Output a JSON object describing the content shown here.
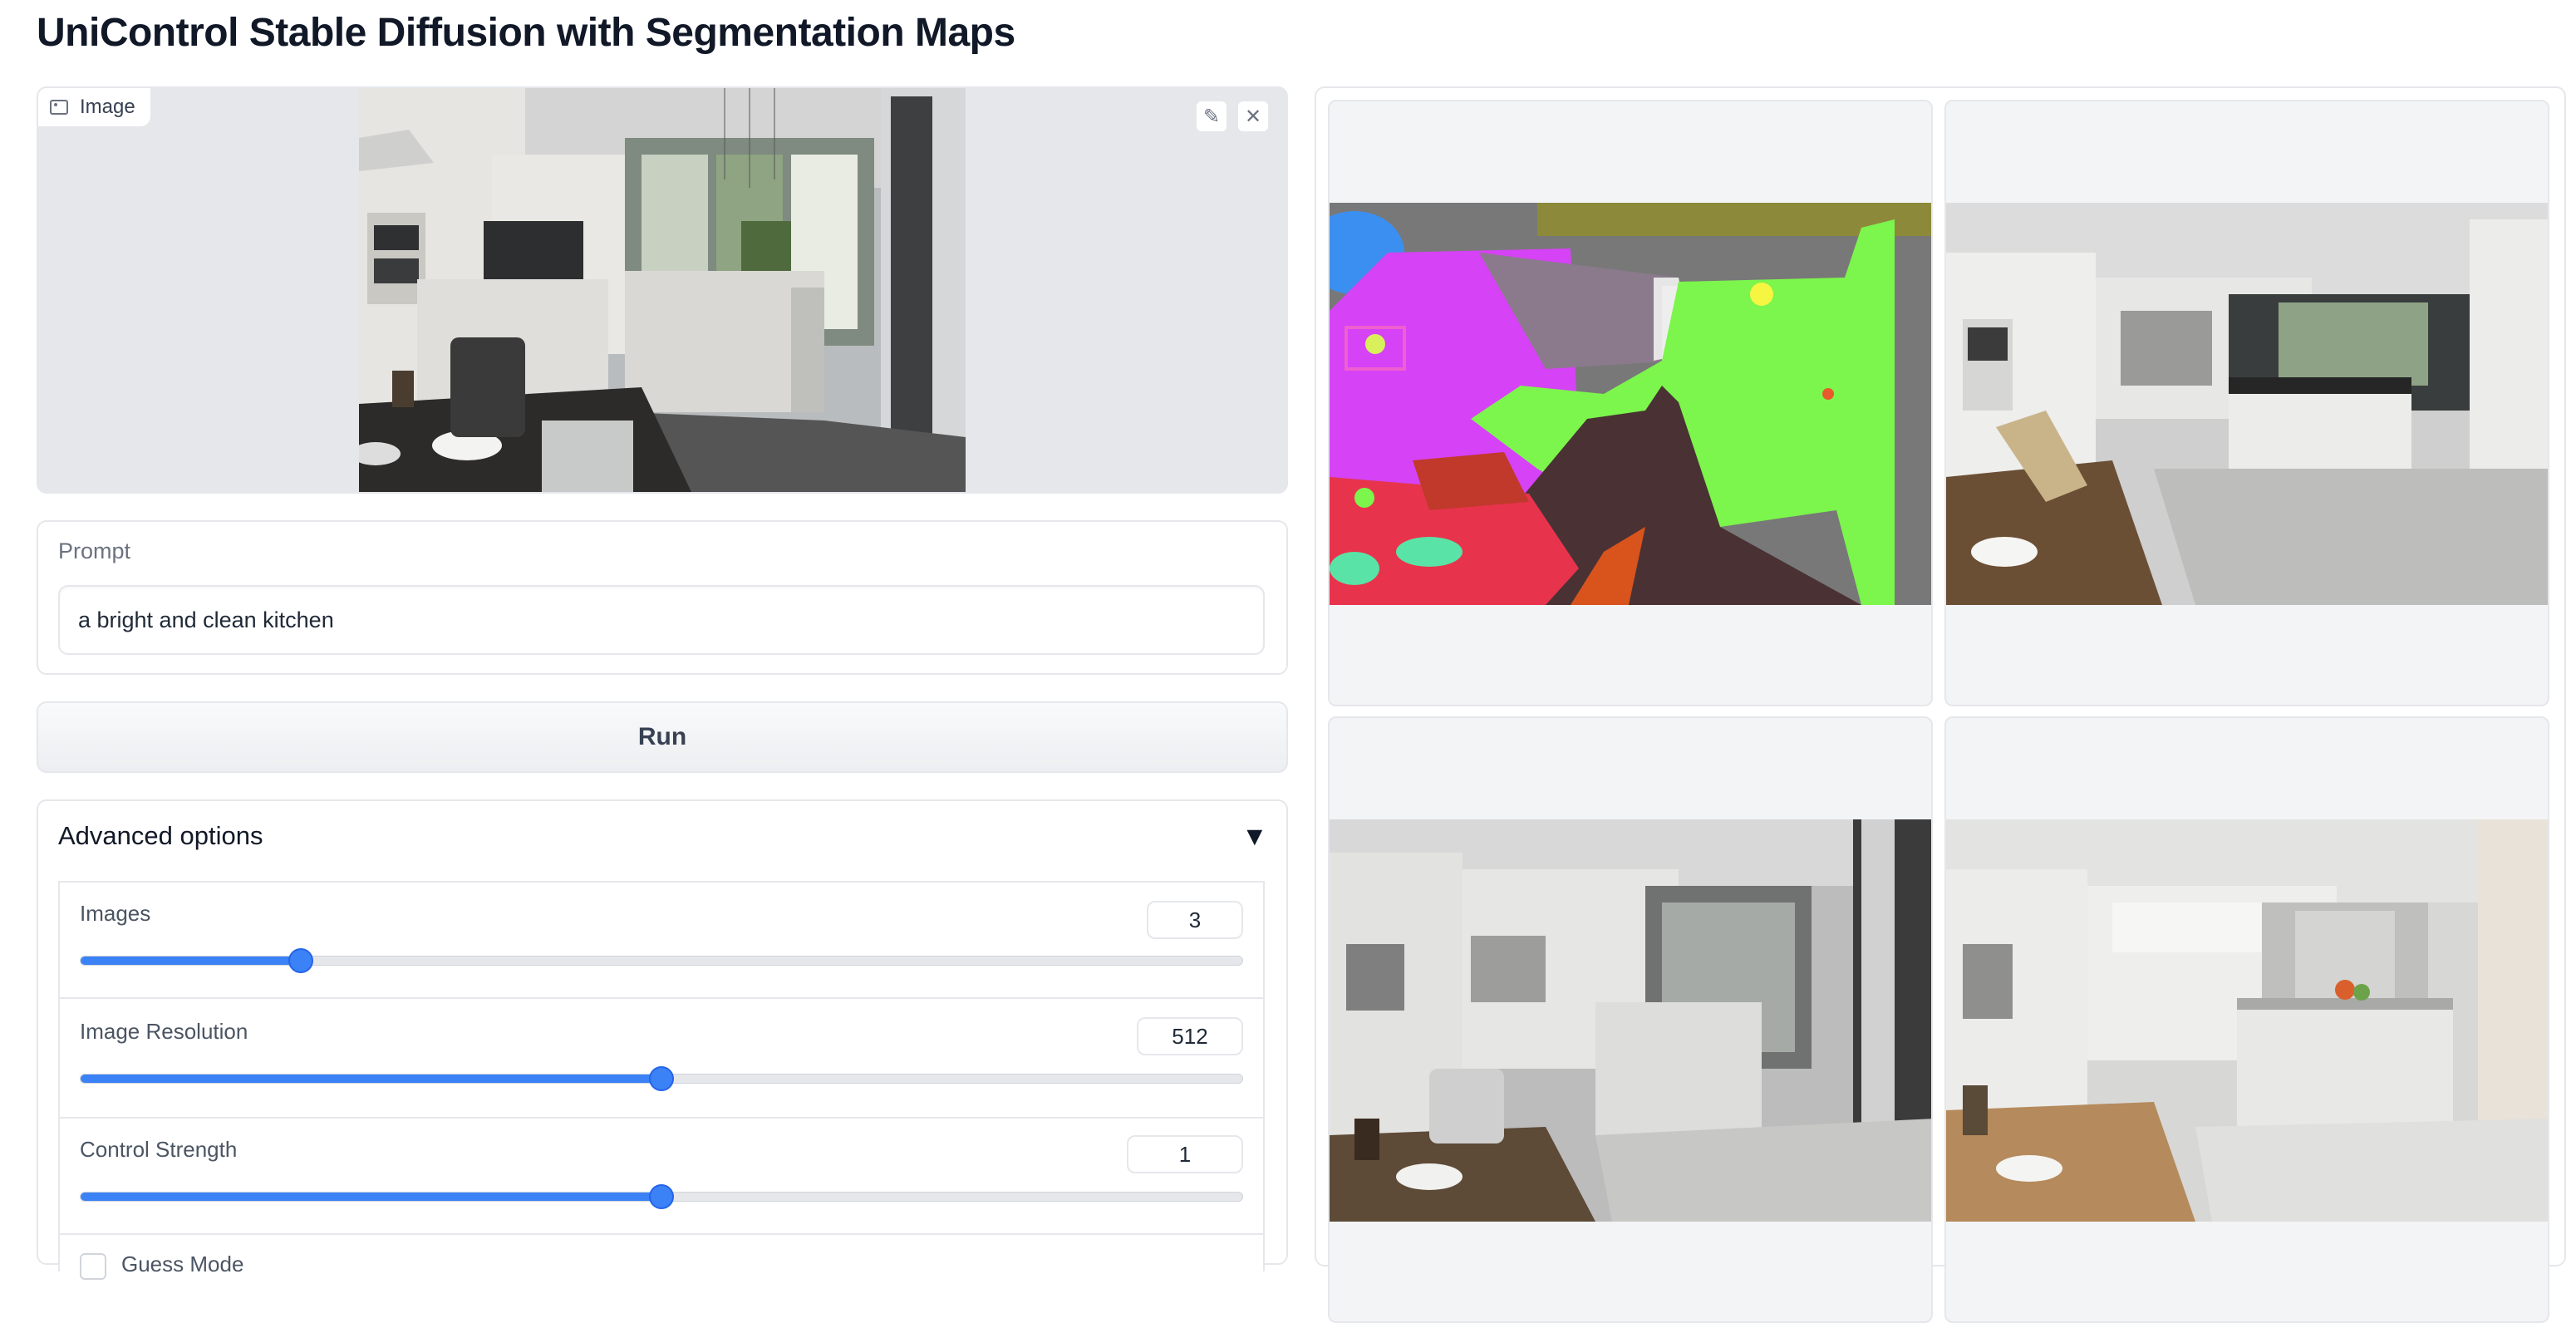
{
  "title": "UniControl Stable Diffusion with Segmentation Maps",
  "input": {
    "label": "Image",
    "label_icon": "image-icon",
    "edit_icon": "pencil-icon",
    "clear_icon": "close-icon"
  },
  "prompt": {
    "label": "Prompt",
    "value": "a bright and clean kitchen"
  },
  "run_label": "Run",
  "advanced": {
    "title": "Advanced options",
    "toggle_icon": "▼",
    "sliders": [
      {
        "label": "Images",
        "value": "3",
        "fraction": 0.19
      },
      {
        "label": "Image Resolution",
        "value": "512",
        "fraction": 0.5
      },
      {
        "label": "Control Strength",
        "value": "1",
        "fraction": 0.5
      }
    ],
    "checkbox_label": "Guess Mode"
  },
  "colors": {
    "accent": "#3b82f6",
    "panel_border": "#e5e7eb",
    "seg_purple": "#d642f5",
    "seg_green": "#7cf54c",
    "seg_red": "#e8334d",
    "seg_brown": "#4a3234"
  }
}
